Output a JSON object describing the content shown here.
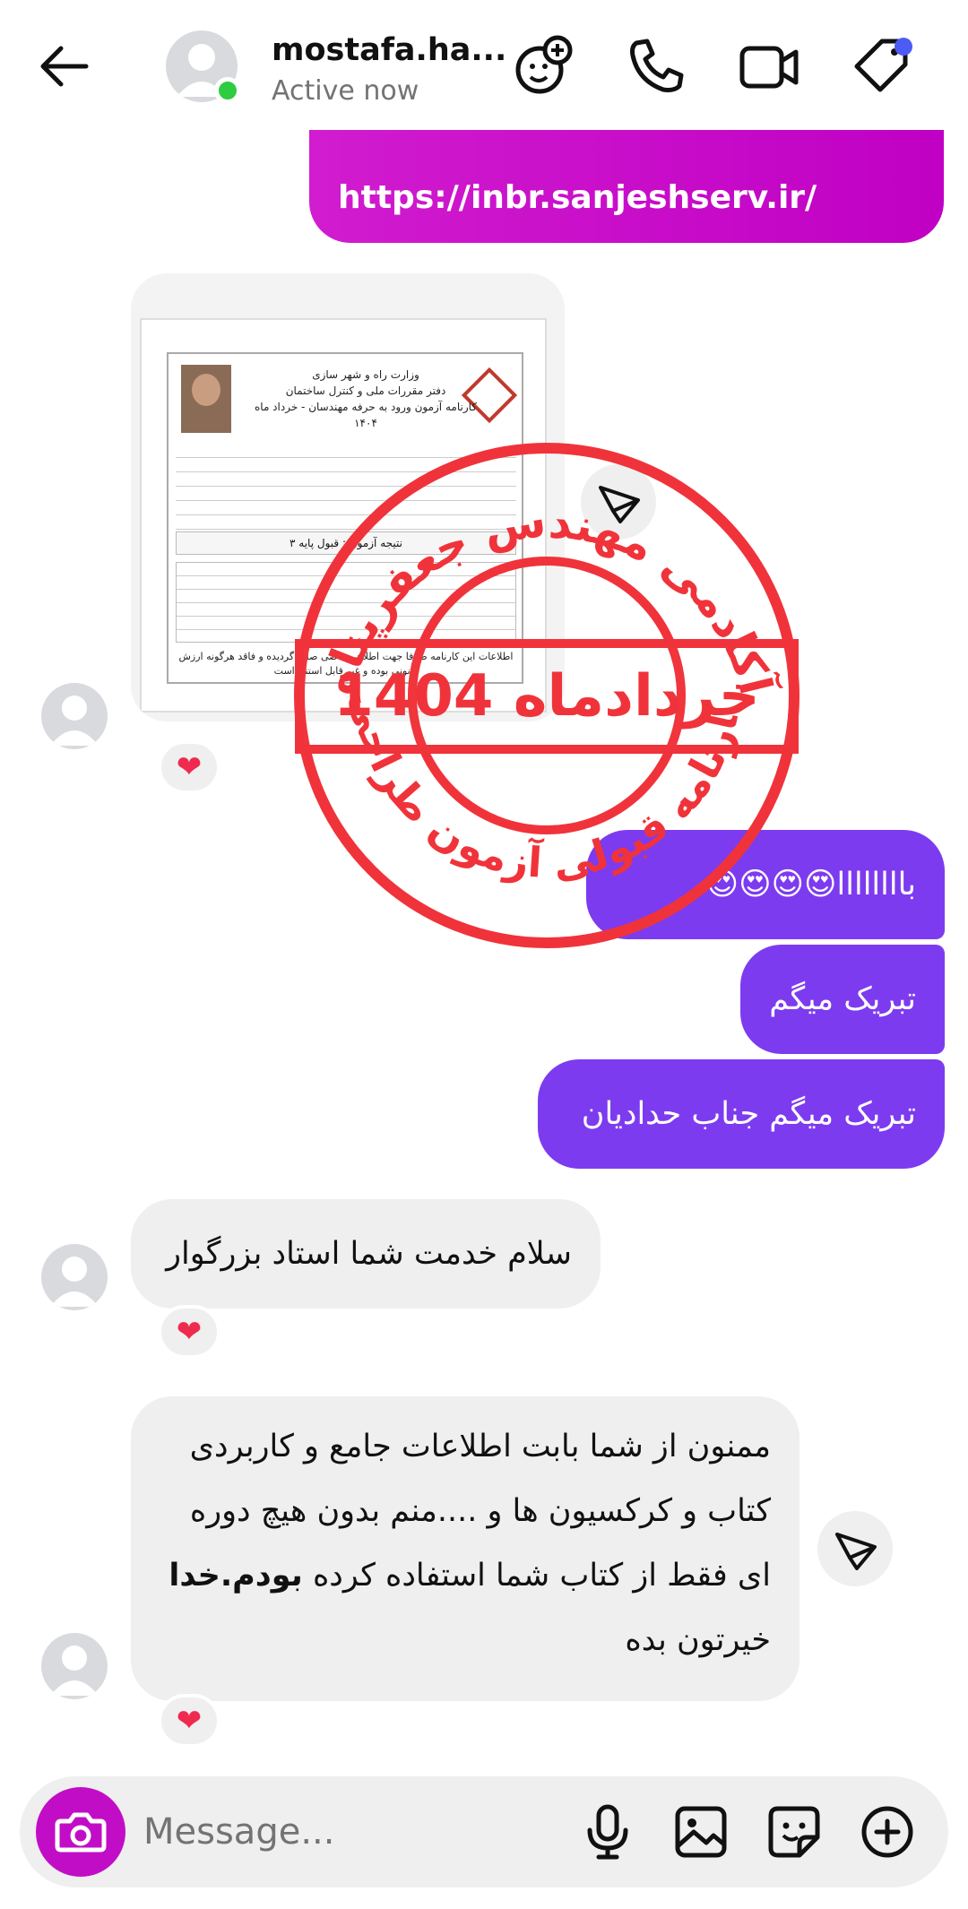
{
  "header": {
    "contact_name": "mostafa.ha...",
    "status": "Active now",
    "icons": [
      "back-arrow-icon",
      "add-effect-icon",
      "phone-icon",
      "video-call-icon",
      "tag-icon"
    ],
    "accent_online": "#2ecc40",
    "accent_tag_dot": "#4d5bf5"
  },
  "messages": {
    "link": "https://inbr.sanjeshserv.ir/",
    "doc_image": {
      "title": "وزارت راه و شهر سازی\nدفتر مقررات ملی و کنترل ساختمان\nکارنامه آزمون ورود به حرفه مهندسان - خرداد ماه ۱۴۰۴",
      "result": "نتیجه آزمون : قبول پایه ۳",
      "footer": "اطلاعات این کارنامه صرفا جهت اطلاع متقاضی صادر گردیده و فاقد هرگونه ارزش قانونی بوده و غیر قابل استناد است"
    },
    "out_1": "باااااااا😍😍😍😍",
    "out_2": "تبریک میگم",
    "out_3": "تبریک میگم جناب حدادیان",
    "in_1": "سلام خدمت شما استاد بزرگوار",
    "in_2_line_1": "ممنون از شما بابت اطلاعات جامع و کاربردی",
    "in_2_line_2": "کتاب و کرکسیون ها و ....منم بدون هیچ دوره",
    "in_2_line_3a": "ای فقط از کتاب شما استفاده کرده",
    "in_2_line_3b": "بودم.خدا",
    "in_2_line_4": "خیرتون بده",
    "reaction": "❤"
  },
  "stamp": {
    "top_text": "آکادمی مهندس جعفرپناه",
    "center_text": "خردادماه 1404",
    "bottom_text": "کارنامه قبولی آزمون طراحی",
    "color": "#f0333a"
  },
  "composer": {
    "placeholder": "Message...",
    "icons": [
      "camera-icon",
      "microphone-icon",
      "gallery-icon",
      "sticker-icon",
      "add-icon"
    ],
    "camera_color": "#c10ec6"
  },
  "colors": {
    "link_bubble": "#c90ec8",
    "outgoing_purple": "#7d3bf0",
    "incoming_gray": "#efefef"
  }
}
